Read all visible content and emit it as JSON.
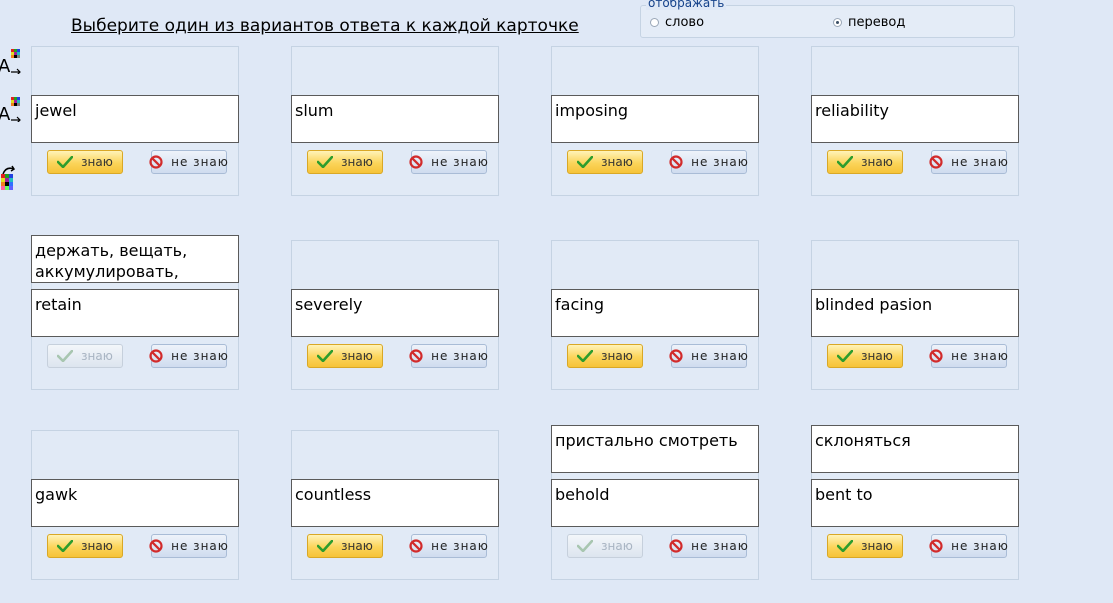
{
  "header": {
    "title": "Выберите один из вариантов ответа к каждой карточке"
  },
  "display": {
    "legend": "отображать",
    "options": [
      {
        "label": "слово",
        "selected": false
      },
      {
        "label": "перевод",
        "selected": true
      }
    ]
  },
  "buttons": {
    "know_label": "знаю",
    "dont_know_label": "не знаю"
  },
  "cards": [
    {
      "word": "jewel",
      "translation": "",
      "know_disabled": false
    },
    {
      "word": "slum",
      "translation": "",
      "know_disabled": false
    },
    {
      "word": "imposing",
      "translation": "",
      "know_disabled": false
    },
    {
      "word": "reliability",
      "translation": "",
      "know_disabled": false
    },
    {
      "word": "retain",
      "translation": "держать, вещать, аккумулировать,",
      "know_disabled": true
    },
    {
      "word": "severely",
      "translation": "",
      "know_disabled": false
    },
    {
      "word": "facing",
      "translation": "",
      "know_disabled": false
    },
    {
      "word": "blinded pasion",
      "translation": "",
      "know_disabled": false
    },
    {
      "word": "gawk",
      "translation": "",
      "know_disabled": false
    },
    {
      "word": "countless",
      "translation": "",
      "know_disabled": false
    },
    {
      "word": "behold",
      "translation": "пристально смотреть",
      "know_disabled": true
    },
    {
      "word": "bent to",
      "translation": "склоняться",
      "know_disabled": false
    }
  ],
  "colors": {
    "background": "#dfe8f6",
    "know_button": "#fbd45a",
    "dont_know_button": "#cfdcef",
    "check_green": "#2e9d2e",
    "forbidden_red": "#d22b2b"
  },
  "icons": [
    "font-color-icon",
    "font-color-icon",
    "color-swap-icon",
    "check-icon",
    "forbidden-icon"
  ]
}
